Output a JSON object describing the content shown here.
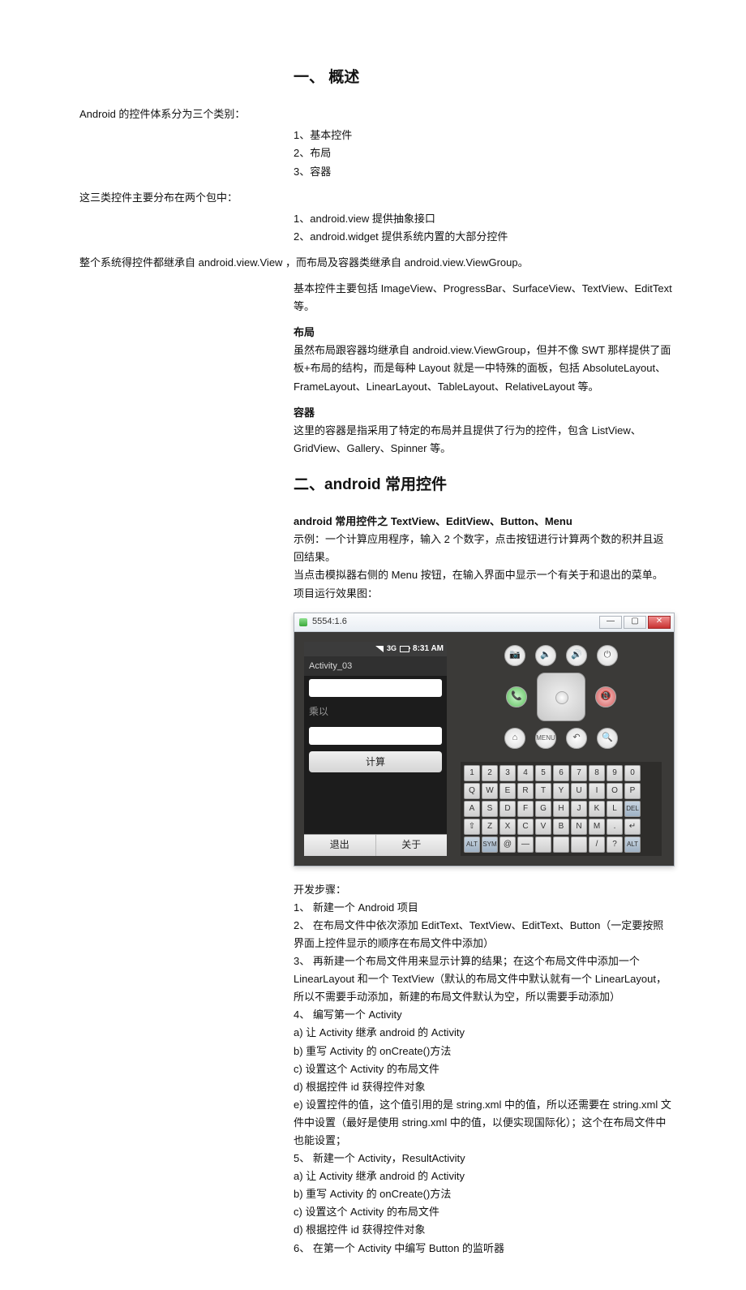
{
  "section1": {
    "title": "一、 概述",
    "intro": "Android 的控件体系分为三个类别：",
    "categories": [
      "1、基本控件",
      "2、布局",
      "3、容器"
    ],
    "pkg_intro": "这三类控件主要分布在两个包中：",
    "packages": [
      "1、android.view 提供抽象接口",
      "2、android.widget 提供系统内置的大部分控件"
    ],
    "inherit": "整个系统得控件都继承自 android.view.View ，而布局及容器类继承自 android.view.ViewGroup。",
    "basic_widgets": "基本控件主要包括 ImageView、ProgressBar、SurfaceView、TextView、EditText 等。",
    "layout_title": "布局",
    "layout_text": "虽然布局跟容器均继承自 android.view.ViewGroup，但并不像 SWT 那样提供了面板+布局的结构，而是每种 Layout 就是一中特殊的面板，包括 AbsoluteLayout、FrameLayout、LinearLayout、TableLayout、RelativeLayout 等。",
    "container_title": "容器",
    "container_text": "这里的容器是指采用了特定的布局并且提供了行为的控件，包含 ListView、GridView、Gallery、Spinner 等。"
  },
  "section2": {
    "title": "二、android 常用控件",
    "sub_title": "android 常用控件之 TextView、EditView、Button、Menu",
    "example1": "示例：一个计算应用程序，输入 2 个数字，点击按钮进行计算两个数的积并且返回结果。",
    "example2": "当点击模拟器右侧的 Menu 按钮，在输入界面中显示一个有关于和退出的菜单。",
    "example3": "项目运行效果图：",
    "emulator": {
      "window_title": "5554:1.6",
      "status_time": "8:31 AM",
      "activity_title": "Activity_03",
      "label_multiply": "乘以",
      "btn_calc": "计算",
      "btn_exit": "退出",
      "btn_about": "关于",
      "keys": [
        [
          "1",
          "2",
          "3",
          "4",
          "5",
          "6",
          "7",
          "8",
          "9",
          "0"
        ],
        [
          "Q",
          "W",
          "E",
          "R",
          "T",
          "Y",
          "U",
          "I",
          "O",
          "P"
        ],
        [
          "A",
          "S",
          "D",
          "F",
          "G",
          "H",
          "J",
          "K",
          "L",
          "DEL"
        ],
        [
          "⇧",
          "Z",
          "X",
          "C",
          "V",
          "B",
          "N",
          "M",
          ".",
          "↵"
        ],
        [
          "ALT",
          "SYM",
          "@",
          "—",
          "",
          "",
          "",
          "/",
          "?",
          "ALT"
        ]
      ]
    },
    "steps_title": "开发步骤：",
    "steps": [
      "1、 新建一个 Android 项目",
      "2、 在布局文件中依次添加 EditText、TextView、EditText、Button（一定要按照界面上控件显示的顺序在布局文件中添加）",
      "3、 再新建一个布局文件用来显示计算的结果；在这个布局文件中添加一个 LinearLayout 和一个 TextView（默认的布局文件中默认就有一个 LinearLayout，所以不需要手动添加，新建的布局文件默认为空，所以需要手动添加）",
      "4、 编写第一个 Activity",
      "a)  让 Activity 继承 android 的 Activity",
      "b)  重写 Activity 的 onCreate()方法",
      "c)  设置这个 Activity 的布局文件",
      "d)  根据控件 id 获得控件对象",
      "e)  设置控件的值，这个值引用的是 string.xml 中的值，所以还需要在 string.xml 文件中设置（最好是使用 string.xml 中的值，以便实现国际化）；这个在布局文件中也能设置；",
      "5、 新建一个 Activity，ResultActivity",
      "a)  让 Activity 继承 android 的 Activity",
      "b)  重写 Activity 的 onCreate()方法",
      "c)  设置这个 Activity 的布局文件",
      "d)  根据控件 id 获得控件对象",
      "6、 在第一个 Activity 中编写 Button 的监听器"
    ]
  }
}
